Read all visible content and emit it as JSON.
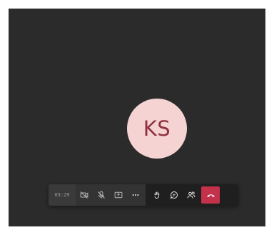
{
  "call": {
    "participant_initials": "KS",
    "timer": "03:29"
  },
  "toolbar": {
    "buttons": [
      {
        "icon": "camera-off-icon"
      },
      {
        "icon": "mic-off-icon"
      },
      {
        "icon": "share-screen-icon"
      },
      {
        "icon": "more-options-icon"
      },
      {
        "icon": "raise-hand-icon"
      },
      {
        "icon": "chat-icon"
      },
      {
        "icon": "participants-icon"
      },
      {
        "icon": "hang-up-icon"
      }
    ]
  },
  "colors": {
    "stage_background": "#2b2b2b",
    "avatar_background": "#f4d3d2",
    "avatar_text": "#92323f",
    "toolbar_background": "#1f1f1f",
    "hangup": "#c4314b"
  }
}
